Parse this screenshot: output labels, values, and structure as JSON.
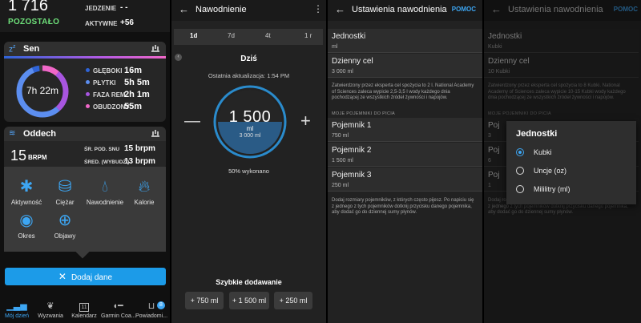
{
  "screen1": {
    "calories_value": "1 716",
    "remaining_label": "POZOSTAŁO",
    "food_label": "JEDZENIE",
    "food_value": "- -",
    "active_label": "AKTYWNE",
    "active_value": "+56",
    "sleep": {
      "title": "Sen",
      "total": "7h 22m",
      "legend": [
        {
          "label": "GŁĘBOKI",
          "value": "16m",
          "color": "#2f64d8"
        },
        {
          "label": "PŁYTKI",
          "value": "5h 5m",
          "color": "#5c8ef0"
        },
        {
          "label": "FAZA REM",
          "value": "2h 1m",
          "color": "#a855e0"
        },
        {
          "label": "OBUDZONY",
          "value": "55m",
          "color": "#f067c8"
        }
      ]
    },
    "breath": {
      "title": "Oddech",
      "value": "15",
      "unit": "BRPM",
      "avg_sleep_label": "ŚR. POD. SNU",
      "avg_sleep_value": "15 brpm",
      "avg_awake_label": "ŚRED. (WYBUDZ.)",
      "avg_awake_value": "13 brpm"
    },
    "activities": [
      {
        "label": "Aktywność",
        "icon": "person-icon"
      },
      {
        "label": "Ciężar",
        "icon": "scale-icon"
      },
      {
        "label": "Nawodnienie",
        "icon": "drop-icon"
      },
      {
        "label": "Kalorie",
        "icon": "flame-icon"
      },
      {
        "label": "Okres",
        "icon": "cycle-icon"
      },
      {
        "label": "Objawy",
        "icon": "plus-circle-icon"
      }
    ],
    "add_data_label": "Dodaj dane",
    "nav": [
      {
        "label": "Mój dzień"
      },
      {
        "label": "Wyzwania"
      },
      {
        "label": "Kalendarz"
      },
      {
        "label": "Garmin Coa..."
      },
      {
        "label": "Powiadomi..."
      }
    ],
    "notification_count": "8",
    "calendar_day": "11"
  },
  "screen2": {
    "title": "Nawodnienie",
    "periods": [
      "1d",
      "7d",
      "4t",
      "1 r"
    ],
    "selected_period": "1d",
    "today_label": "Dziś",
    "last_update": "Ostatnia aktualizacja: 1:54 PM",
    "intake_value": "1 500",
    "intake_unit": "ml",
    "goal_value": "3 000 ml",
    "progress_fraction": 0.5,
    "percent_done": "50% wykonano",
    "quick_add_title": "Szybkie dodawanie",
    "quick_add": [
      "+ 750 ml",
      "+ 1 500 ml",
      "+ 250 ml"
    ]
  },
  "screen3": {
    "title": "Ustawienia nawodnienia",
    "help_label": "POMOC",
    "units_title": "Jednostki",
    "units_value": "ml",
    "goal_title": "Dzienny cel",
    "goal_value": "3 000 ml",
    "goal_note": "Zatwierdzony przez eksperta cel spożycia to 2 l. National Academy of Sciences zaleca wypicie 2,5-3,5 l wody każdego dnia pochodzącej ze wszystkich źródeł żywności i napojów.",
    "containers_section": "MOJE POJEMNIKI DO PICIA",
    "containers": [
      {
        "title": "Pojemnik 1",
        "value": "750 ml"
      },
      {
        "title": "Pojemnik 2",
        "value": "1 500 ml"
      },
      {
        "title": "Pojemnik 3",
        "value": "250 ml"
      }
    ],
    "containers_note": "Dodaj rozmiary pojemników, z których często pijesz. Po napiciu się z jednego z tych pojemników dotknij przycisku danego pojemnika, aby dodać go do dziennej sumy płynów."
  },
  "screen4": {
    "title": "Ustawienia nawodnienia",
    "help_label": "POMOC",
    "units_title": "Jednostki",
    "units_value": "Kubki",
    "goal_title": "Dzienny cel",
    "goal_value": "10 Kubki",
    "goal_note": "Zatwierdzony przez eksperta cel spożycia to 8 Kubki. National Academy of Sciences zaleca wypicie 10-15 Kubki wody każdego dnia pochodzącej ze wszystkich źródeł żywności i napojów.",
    "containers_section": "MOJE POJEMNIKI DO PICIA",
    "container_title_partial": "Poj",
    "container_values_partial": [
      "3",
      "6",
      "1"
    ],
    "containers_note": "Dodaj rozmiary pojemników, z których często pijesz. Po napiciu się z jednego z tych pojemników dotknij przycisku danego pojemnika, aby dodać go do dziennej sumy płynów.",
    "dialog": {
      "title": "Jednostki",
      "options": [
        "Kubki",
        "Uncje (oz)",
        "Mililitry (ml)"
      ],
      "selected": "Kubki"
    }
  },
  "colors": {
    "accent_blue": "#3da6f3",
    "button_blue": "#1c9be8",
    "remaining_green": "#6ee07a"
  }
}
